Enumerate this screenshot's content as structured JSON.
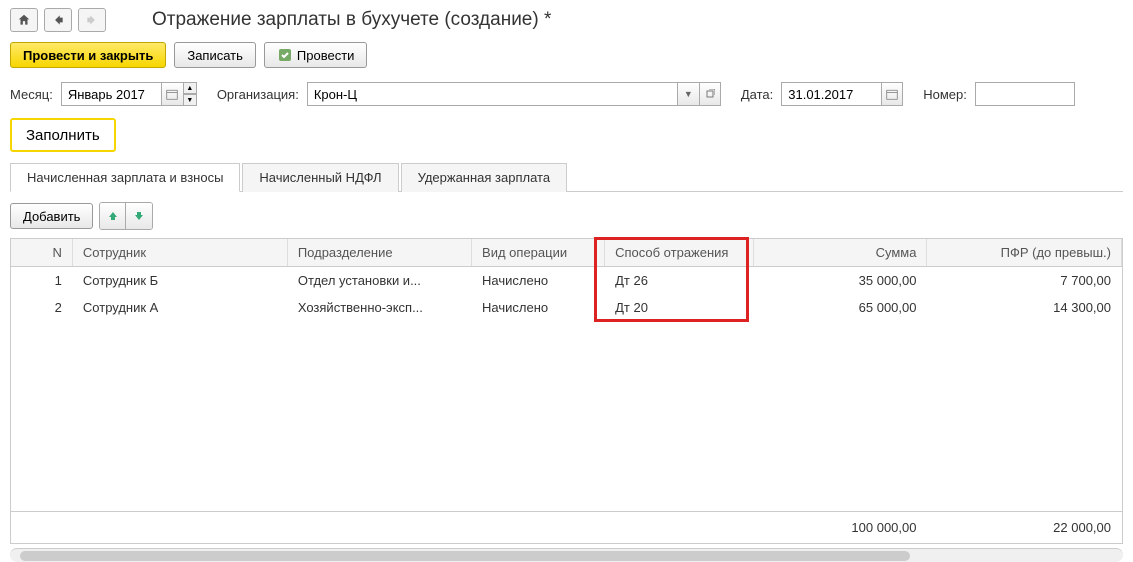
{
  "header": {
    "title": "Отражение зарплаты в бухучете (создание) *"
  },
  "toolbar": {
    "post_close": "Провести и закрыть",
    "save": "Записать",
    "post": "Провести"
  },
  "form": {
    "month_label": "Месяц:",
    "month_value": "Январь 2017",
    "org_label": "Организация:",
    "org_value": "Крон-Ц",
    "date_label": "Дата:",
    "date_value": "31.01.2017",
    "number_label": "Номер:",
    "number_value": ""
  },
  "fill_button": "Заполнить",
  "tabs": [
    {
      "label": "Начисленная зарплата и взносы",
      "active": true
    },
    {
      "label": "Начисленный НДФЛ",
      "active": false
    },
    {
      "label": "Удержанная зарплата",
      "active": false
    }
  ],
  "grid_toolbar": {
    "add": "Добавить"
  },
  "grid": {
    "columns": {
      "n": "N",
      "employee": "Сотрудник",
      "department": "Подразделение",
      "operation": "Вид операции",
      "method": "Способ отражения",
      "sum": "Сумма",
      "pfr": "ПФР (до превыш.)"
    },
    "rows": [
      {
        "n": "1",
        "employee": "Сотрудник Б",
        "department": "Отдел установки и...",
        "operation": "Начислено",
        "method": "Дт 26",
        "sum": "35 000,00",
        "pfr": "7 700,00"
      },
      {
        "n": "2",
        "employee": "Сотрудник А",
        "department": "Хозяйственно-эксп...",
        "operation": "Начислено",
        "method": "Дт 20",
        "sum": "65 000,00",
        "pfr": "14 300,00"
      }
    ],
    "totals": {
      "sum": "100 000,00",
      "pfr": "22 000,00"
    }
  }
}
